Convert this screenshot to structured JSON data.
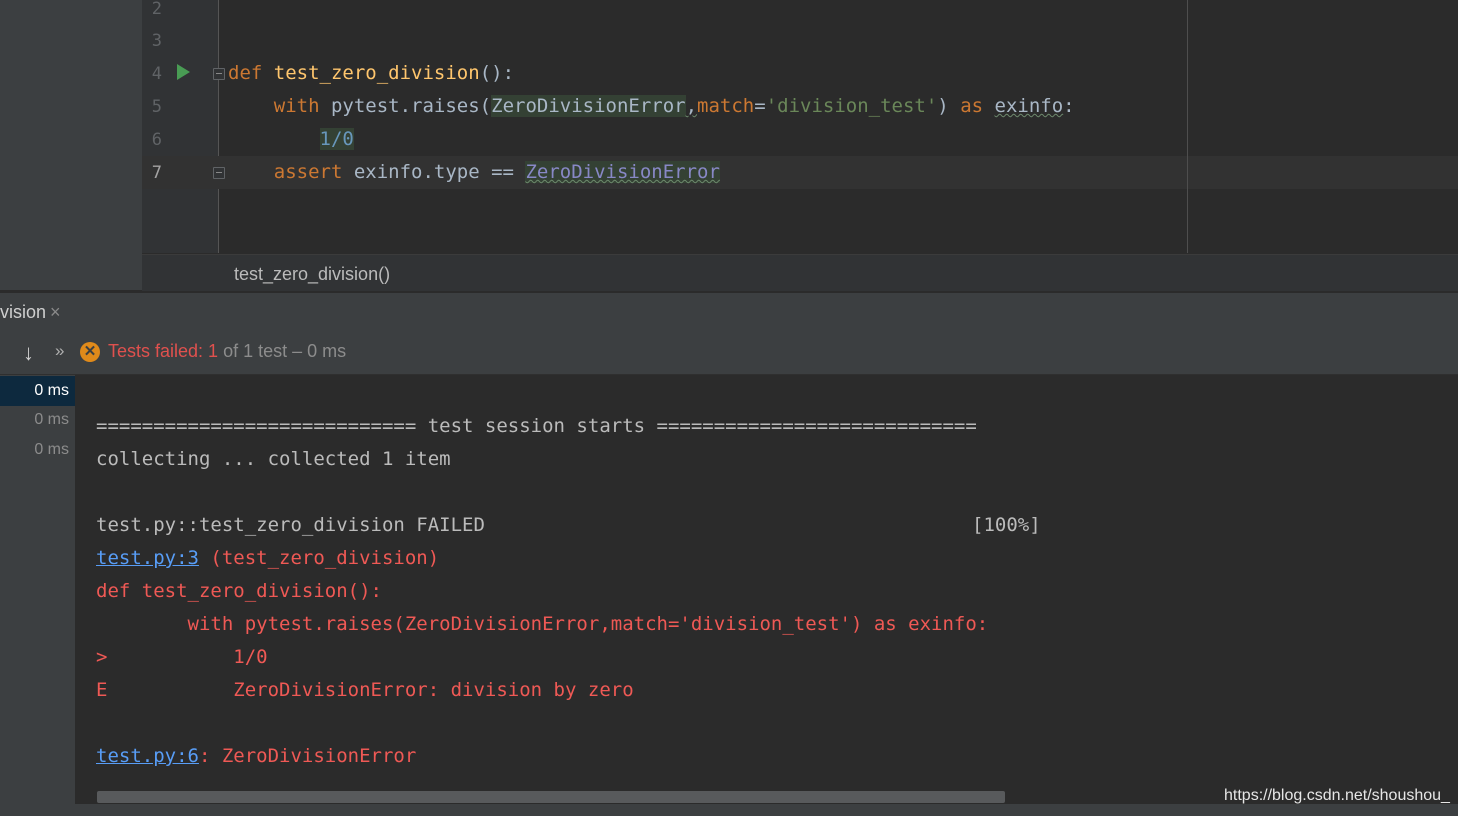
{
  "editor": {
    "line_numbers": [
      "2",
      "3",
      "4",
      "5",
      "6",
      "7"
    ],
    "current_line": "7",
    "line4": {
      "kw": "def",
      "fn": "test_zero_division",
      "rest": "():"
    },
    "line5": {
      "kw": "with",
      "pre": " pytest.raises(",
      "cls": "ZeroDivisionError",
      "comma": ",",
      "param": "match",
      "eq": "=",
      "str": "'division_test'",
      "close": ") ",
      "as": "as",
      "sp": " ",
      "var": "exinfo",
      "colon": ":"
    },
    "line6": {
      "expr": "1/0"
    },
    "line7": {
      "kw": "assert",
      "mid": " exinfo.type == ",
      "cls": "ZeroDivisionError"
    }
  },
  "breadcrumb": {
    "text": "test_zero_division()"
  },
  "tool_window": {
    "tab_label": "vision",
    "close_glyph": "×"
  },
  "toolbar": {
    "icons": [
      "arrow-down-icon",
      "more-icon",
      "fail-icon"
    ],
    "status_failed": "Tests failed: 1",
    "status_rest": " of 1 test – 0 ms"
  },
  "tree": {
    "durations": [
      "0 ms",
      "0 ms",
      "0 ms"
    ]
  },
  "console": {
    "session": "============================ test session starts ============================",
    "collecting": "collecting ... collected 1 item",
    "result_line": "test.py::test_zero_division FAILED",
    "percent": "[100%]",
    "link1": "test.py:3",
    "link1_rest": " (test_zero_division)",
    "def_line": "def test_zero_division():",
    "with_line": "        with pytest.raises(ZeroDivisionError,match='division_test') as exinfo:",
    "gt_line": ">           1/0",
    "e_line": "E           ZeroDivisionError: division by zero",
    "link2": "test.py:6",
    "link2_rest": ": ZeroDivisionError"
  },
  "watermark": "https://blog.csdn.net/shoushou_"
}
